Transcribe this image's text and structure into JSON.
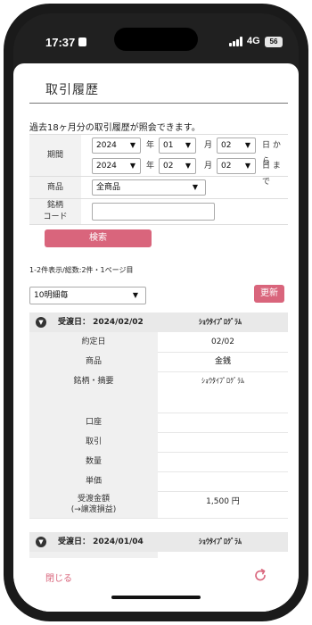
{
  "status_bar": {
    "time": "17:37",
    "network": "4G",
    "battery": "56"
  },
  "page": {
    "title": "取引履歴",
    "notice": "過去18ヶ月分の取引履歴が照会できます。"
  },
  "form": {
    "period_label": "期間",
    "from": {
      "year": "2024",
      "month": "01",
      "day": "02",
      "suffix": "日 から"
    },
    "to": {
      "year": "2024",
      "month": "02",
      "day": "02",
      "suffix": "日 まで"
    },
    "unit_year": "年",
    "unit_month": "月",
    "product_label": "商品",
    "product_value": "全商品",
    "code_label": "銘柄\nコード",
    "code_value": "",
    "search_button": "検索"
  },
  "results": {
    "count_text": "1-2件表示/総数:2件・1ページ目",
    "per_page": "10明細毎",
    "refresh_button": "更新"
  },
  "records": [
    {
      "header_date": "受渡日： 2024/02/02",
      "header_name": "ｼｮｳﾀｲﾌﾟﾛｸﾞﾗﾑ",
      "rows": [
        {
          "label": "約定日",
          "value": "02/02"
        },
        {
          "label": "商品",
          "value": "金銭"
        },
        {
          "label": "銘柄・摘要",
          "value": "ｼｮｳﾀｲﾌﾟﾛｸﾞﾗﾑ"
        },
        {
          "label": "口座",
          "value": ""
        },
        {
          "label": "取引",
          "value": ""
        },
        {
          "label": "数量",
          "value": ""
        },
        {
          "label": "単価",
          "value": ""
        },
        {
          "label": "受渡金額\n(→譲渡損益)",
          "value": "1,500 円"
        }
      ]
    },
    {
      "header_date": "受渡日： 2024/01/04",
      "header_name": "ｼｮｳﾀｲﾌﾟﾛｸﾞﾗﾑ",
      "rows": []
    }
  ],
  "footer": {
    "close_label": "閉じる"
  },
  "icons": {
    "expand": "chevron-down-icon",
    "reload": "reload-icon",
    "dropdown": "dropdown-arrow-icon"
  },
  "colors": {
    "accent": "#d9657c"
  }
}
